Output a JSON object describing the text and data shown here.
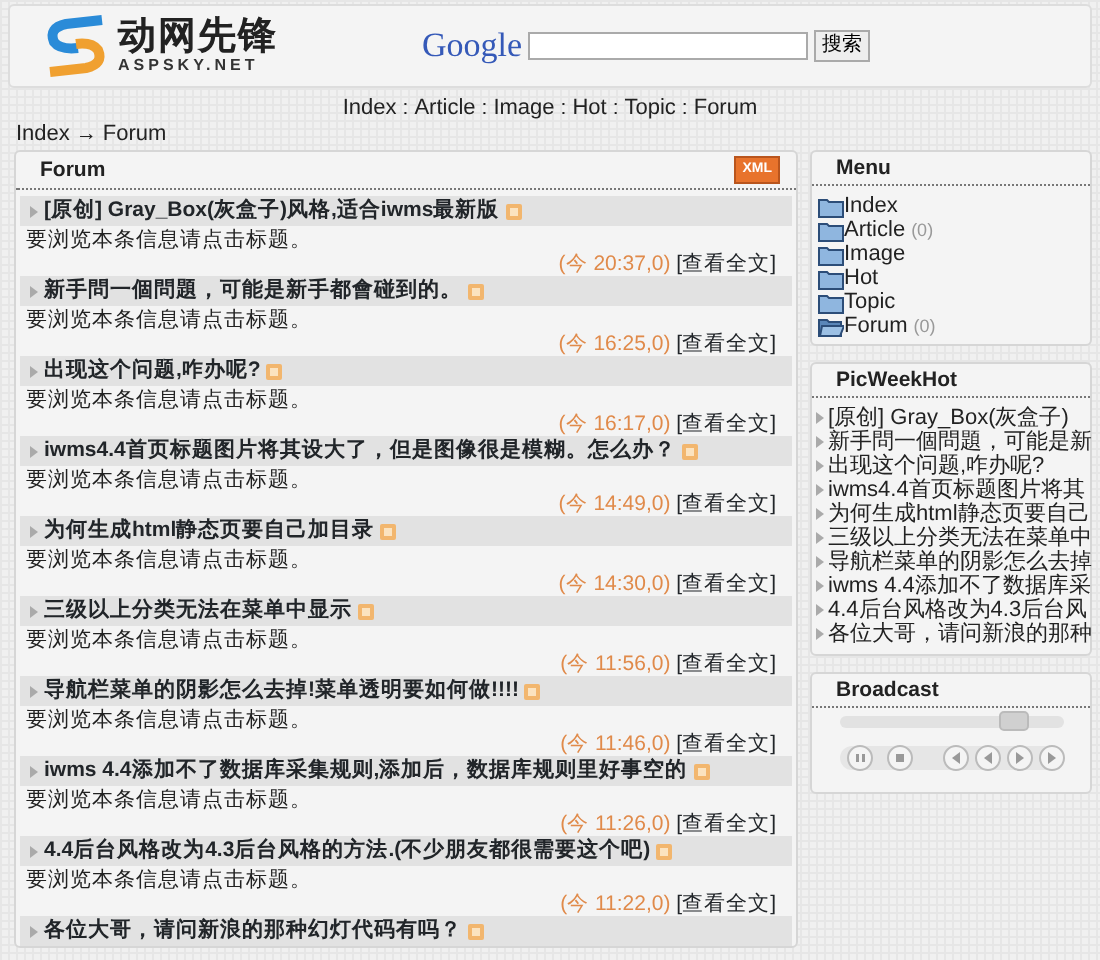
{
  "header": {
    "logo_cn": "动网先锋",
    "logo_en": "ASPSKY.NET",
    "search_brand": "Google",
    "search_button": "搜索"
  },
  "nav": [
    {
      "label": "Index"
    },
    {
      "separator": ":",
      "label": "Article"
    },
    {
      "separator": ":",
      "label": "Image"
    },
    {
      "separator": ":",
      "label": "Hot"
    },
    {
      "separator": ":",
      "label": "Topic"
    },
    {
      "separator": ":",
      "label": "Forum"
    }
  ],
  "breadcrumb": {
    "parts": [
      "Index",
      "Forum"
    ],
    "separator": "→"
  },
  "forum": {
    "title": "Forum",
    "badge": "XML",
    "posts": [
      {
        "title": "[原创] Gray_Box(灰盒子)风格,适合iwms最新版",
        "summary": "要浏览本条信息请点击标题。",
        "time": "(今 20:37,0)",
        "more": "[查看全文]"
      },
      {
        "title": "新手問一個問題，可能是新手都會碰到的。",
        "summary": "要浏览本条信息请点击标题。",
        "time": "(今 16:25,0)",
        "more": "[查看全文]"
      },
      {
        "title": "出现这个问题,咋办呢?",
        "summary": "要浏览本条信息请点击标题。",
        "time": "(今 16:17,0)",
        "more": "[查看全文]"
      },
      {
        "title": "iwms4.4首页标题图片将其设大了，但是图像很是模糊。怎么办？",
        "summary": "要浏览本条信息请点击标题。",
        "time": "(今 14:49,0)",
        "more": "[查看全文]"
      },
      {
        "title": "为何生成html静态页要自己加目录",
        "summary": "要浏览本条信息请点击标题。",
        "time": "(今 14:30,0)",
        "more": "[查看全文]"
      },
      {
        "title": "三级以上分类无法在菜单中显示",
        "summary": "要浏览本条信息请点击标题。",
        "time": "(今 11:56,0)",
        "more": "[查看全文]"
      },
      {
        "title": "导航栏菜单的阴影怎么去掉!菜单透明要如何做!!!!",
        "summary": "要浏览本条信息请点击标题。",
        "time": "(今 11:46,0)",
        "more": "[查看全文]"
      },
      {
        "title": "iwms 4.4添加不了数据库采集规则,添加后，数据库规则里好事空的",
        "summary": "要浏览本条信息请点击标题。",
        "time": "(今 11:26,0)",
        "more": "[查看全文]"
      },
      {
        "title": "4.4后台风格改为4.3后台风格的方法.(不少朋友都很需要这个吧)",
        "summary": "要浏览本条信息请点击标题。",
        "time": "(今 11:22,0)",
        "more": "[查看全文]"
      },
      {
        "title": "各位大哥，请问新浪的那种幻灯代码有吗？"
      }
    ]
  },
  "menu": {
    "title": "Menu",
    "items": [
      {
        "label": "Index",
        "selected": false
      },
      {
        "label": "Article",
        "count": "(0)",
        "selected": false
      },
      {
        "label": "Image",
        "selected": false
      },
      {
        "label": "Hot",
        "selected": false
      },
      {
        "label": "Topic",
        "selected": false
      },
      {
        "label": "Forum",
        "count": "(0)",
        "selected": true
      }
    ]
  },
  "pic_week_hot": {
    "title": "PicWeekHot",
    "items": [
      "[原创] Gray_Box(灰盒子)",
      "新手問一個問題，可能是新",
      "出现这个问题,咋办呢?",
      "iwms4.4首页标题图片将其",
      "为何生成html静态页要自己",
      "三级以上分类无法在菜单中",
      "导航栏菜单的阴影怎么去掉",
      "iwms 4.4添加不了数据库采",
      "4.4后台风格改为4.3后台风",
      "各位大哥，请问新浪的那种"
    ]
  },
  "broadcast": {
    "title": "Broadcast"
  }
}
